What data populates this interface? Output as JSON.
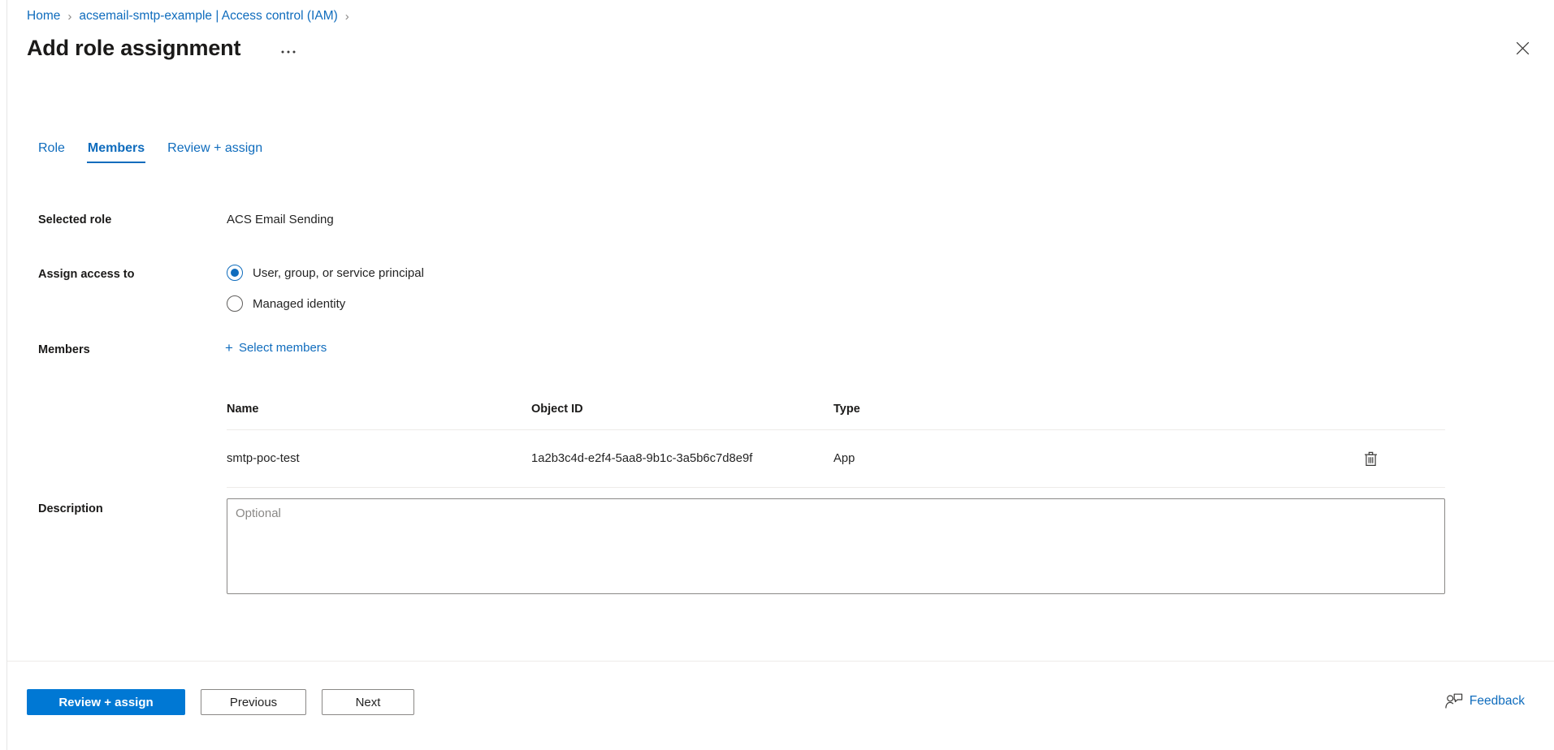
{
  "breadcrumb": {
    "items": [
      {
        "label": "Home",
        "icon": "none"
      },
      {
        "label": "acsemail-smtp-example | Access control (IAM)",
        "icon": "none"
      }
    ],
    "separator": "›"
  },
  "header": {
    "title": "Add role assignment",
    "ellipsis_label": "…",
    "close_icon": "close-icon"
  },
  "tabs": [
    {
      "label": "Role",
      "active": false
    },
    {
      "label": "Members",
      "active": true
    },
    {
      "label": "Review + assign",
      "active": false
    }
  ],
  "form": {
    "selected_role": {
      "label": "Selected role",
      "value": "ACS Email Sending"
    },
    "assign_access_to": {
      "label": "Assign access to",
      "options": [
        {
          "label": "User, group, or service principal",
          "selected": true
        },
        {
          "label": "Managed identity",
          "selected": false
        }
      ]
    },
    "members": {
      "label": "Members",
      "select_members_label": "Select members",
      "plus_icon": "plus-icon"
    },
    "description": {
      "label": "Description",
      "placeholder": "Optional",
      "value": ""
    }
  },
  "members_table": {
    "columns": [
      "Name",
      "Object ID",
      "Type",
      ""
    ],
    "rows": [
      {
        "name": "smtp-poc-test",
        "object_id": "1a2b3c4d-e2f4-5aa8-9b1c-3a5b6c7d8e9f",
        "type": "App",
        "delete_icon": "trash-icon"
      }
    ]
  },
  "footer": {
    "review_assign_label": "Review + assign",
    "previous_label": "Previous",
    "next_label": "Next",
    "feedback_label": "Feedback",
    "feedback_icon": "feedback-person-icon"
  },
  "colors": {
    "accent": "#0078d4",
    "link": "#0f6cbd",
    "text": "#242424",
    "heading": "#1b1a19",
    "border": "#8a8886",
    "divider": "#edebe9"
  }
}
